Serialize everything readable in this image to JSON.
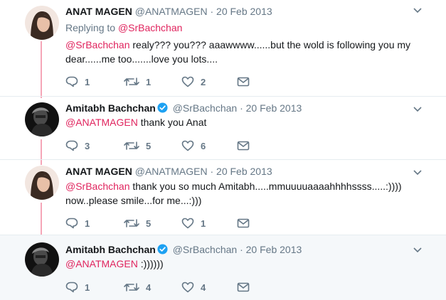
{
  "tweets": [
    {
      "name": "ANAT MAGEN",
      "handle": "@ANATMAGEN",
      "sep": "·",
      "date": "20 Feb 2013",
      "verified": false,
      "replying_label": "Replying to ",
      "replying_to": "@SrBachchan",
      "mention": "@SrBachchan",
      "text_line1": " realy??? you??? aaawwww......but the wold is following you my",
      "text_line2": "dear......me too.......love you lots....",
      "reply_count": "1",
      "retweet_count": "1",
      "like_count": "2"
    },
    {
      "name": "Amitabh Bachchan",
      "handle": "@SrBachchan",
      "sep": "·",
      "date": "20 Feb 2013",
      "verified": true,
      "mention": "@ANATMAGEN",
      "text_line1": " thank you Anat",
      "reply_count": "3",
      "retweet_count": "5",
      "like_count": "6"
    },
    {
      "name": "ANAT MAGEN",
      "handle": "@ANATMAGEN",
      "sep": "·",
      "date": "20 Feb 2013",
      "verified": false,
      "mention": "@SrBachchan",
      "text_line1": " thank you so much Amitabh.....mmuuuuaaaahhhhssss.....:))))",
      "text_line2": "now..please smile...for me...:)))",
      "reply_count": "1",
      "retweet_count": "5",
      "like_count": "1"
    },
    {
      "name": "Amitabh Bachchan",
      "handle": "@SrBachchan",
      "sep": "·",
      "date": "20 Feb 2013",
      "verified": true,
      "mention": "@ANATMAGEN",
      "text_line1": " :))))))",
      "reply_count": "1",
      "retweet_count": "4",
      "like_count": "4"
    }
  ],
  "colors": {
    "mention": "#e0245e",
    "thread_line": "#f5a6b8",
    "verified": "#1da1f2",
    "muted": "#657786"
  }
}
